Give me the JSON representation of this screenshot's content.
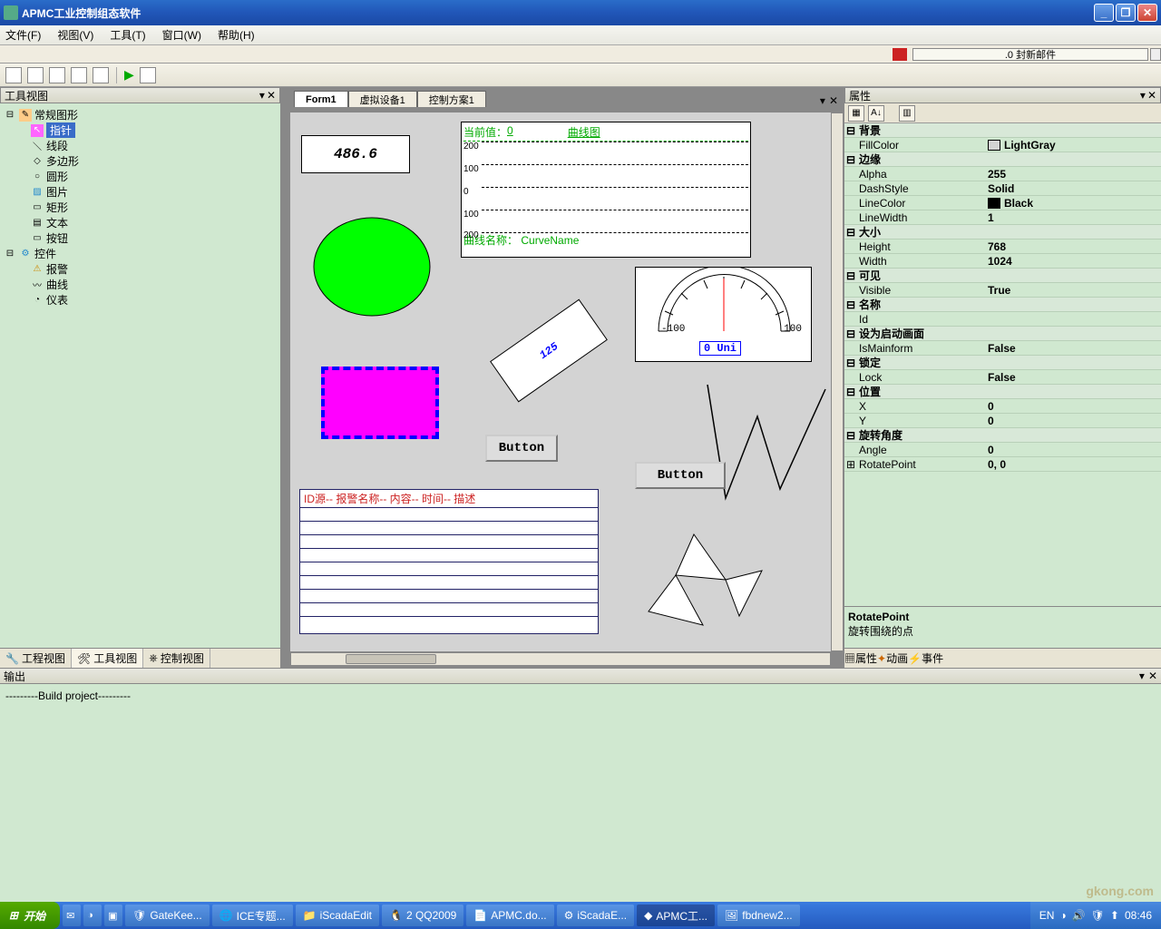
{
  "window": {
    "title": "APMC工业控制组态软件"
  },
  "menu": [
    "文件(F)",
    "视图(V)",
    "工具(T)",
    "窗口(W)",
    "帮助(H)"
  ],
  "mail_text": ".0 封新邮件",
  "left_panel": {
    "title": "工具视图",
    "group1": "常规图形",
    "items1": [
      "指针",
      "线段",
      "多边形",
      "圆形",
      "图片",
      "矩形",
      "文本",
      "按钮"
    ],
    "group2": "控件",
    "items2": [
      "报警",
      "曲线",
      "仪表"
    ],
    "tabs": [
      "工程视图",
      "工具视图",
      "控制视图"
    ]
  },
  "center": {
    "tabs": [
      "Form1",
      "虚拟设备1",
      "控制方案1"
    ],
    "textbox_value": "486.6",
    "rotated_value": "125",
    "curve": {
      "current_label": "当前值：",
      "current_value": "0",
      "title": "曲线图",
      "ticks": [
        "200",
        "100",
        "0",
        "100",
        "200"
      ],
      "name_label": "曲线名称：",
      "name_value": "CurveName"
    },
    "gauge": {
      "left": "-100",
      "right": "100",
      "display": "0 Uni"
    },
    "button_label": "Button",
    "alarm_headers": "ID源--  报警名称--  内容--   时间--   描述"
  },
  "props": {
    "title": "属性",
    "groups": [
      {
        "name": "背景",
        "rows": [
          [
            "FillColor",
            "LightGray",
            "#d3d3d3"
          ]
        ]
      },
      {
        "name": "边缘",
        "rows": [
          [
            "Alpha",
            "255"
          ],
          [
            "DashStyle",
            "Solid"
          ],
          [
            "LineColor",
            "Black",
            "#000"
          ],
          [
            "LineWidth",
            "1"
          ]
        ]
      },
      {
        "name": "大小",
        "rows": [
          [
            "Height",
            "768"
          ],
          [
            "Width",
            "1024"
          ]
        ]
      },
      {
        "name": "可见",
        "rows": [
          [
            "Visible",
            "True"
          ]
        ]
      },
      {
        "name": "名称",
        "rows": [
          [
            "Id",
            ""
          ]
        ]
      },
      {
        "name": "设为启动画面",
        "rows": [
          [
            "IsMainform",
            "False"
          ]
        ]
      },
      {
        "name": "锁定",
        "rows": [
          [
            "Lock",
            "False"
          ]
        ]
      },
      {
        "name": "位置",
        "rows": [
          [
            "X",
            "0"
          ],
          [
            "Y",
            "0"
          ]
        ]
      },
      {
        "name": "旋转角度",
        "rows": [
          [
            "Angle",
            "0"
          ],
          [
            "RotatePoint",
            "0, 0"
          ]
        ]
      }
    ],
    "desc_title": "RotatePoint",
    "desc_body": "旋转围绕的点",
    "tabs": [
      "属性",
      "动画",
      "事件"
    ]
  },
  "output": {
    "title": "输出",
    "text": "---------Build project---------"
  },
  "taskbar": {
    "start": "开始",
    "items": [
      "GateKee...",
      "ICE专题...",
      "iScadaEdit",
      "2 QQ2009",
      "APMC.do...",
      "iScadaE...",
      "APMC工...",
      "fbdnew2..."
    ],
    "lang": "EN",
    "time": "08:46"
  },
  "watermark": "gkong.com"
}
